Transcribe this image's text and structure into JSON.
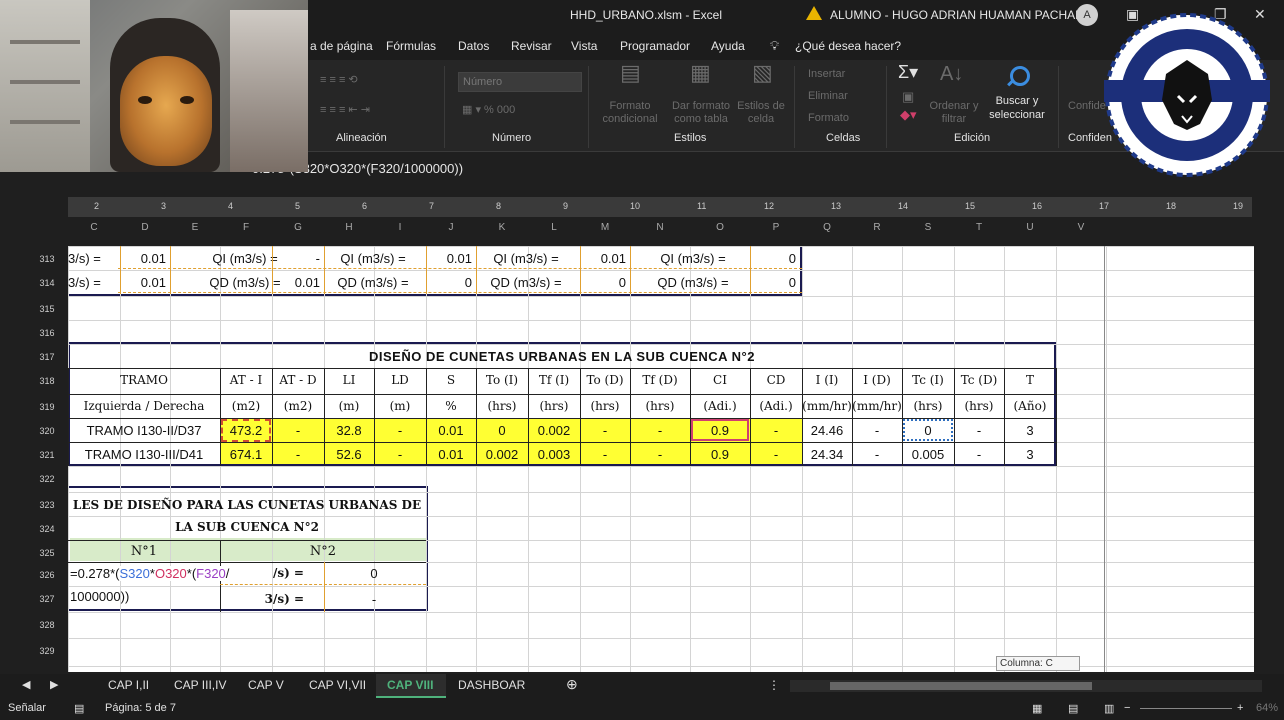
{
  "window": {
    "doc_title": "HHD_URBANO.xlsm  -  Excel",
    "user": "ALUMNO - HUGO ADRIAN HUAMAN PACHARI",
    "avatar": "A"
  },
  "menu": [
    "a de página",
    "Fórmulas",
    "Datos",
    "Revisar",
    "Vista",
    "Programador",
    "Ayuda",
    "¿Qué desea hacer?"
  ],
  "ribbon": {
    "number_format": "Número",
    "groups": [
      "Alineación",
      "Número",
      "Estilos",
      "Celdas",
      "Edición",
      "Confiden"
    ],
    "ghost_buttons": [
      "Formato condicional",
      "Dar formato como tabla",
      "Estilos de celda"
    ],
    "cells_buttons": [
      "Insertar",
      "Eliminar",
      "Formato"
    ],
    "edit_ghost": [
      "Ordenar y filtrar"
    ],
    "search_button": "Buscar y seleccionar",
    "conf_ghost": "Confide"
  },
  "formula_bar": {
    "text": "0.278*(S320*O320*(F320/1000000))"
  },
  "ruler_ticks": [
    "2",
    "3",
    "4",
    "5",
    "6",
    "7",
    "8",
    "9",
    "10",
    "11",
    "12",
    "13",
    "14",
    "15",
    "16",
    "17",
    "18",
    "19"
  ],
  "columns": [
    "C",
    "D",
    "E",
    "F",
    "G",
    "H",
    "I",
    "J",
    "K",
    "L",
    "M",
    "N",
    "O",
    "P",
    "Q",
    "R",
    "S",
    "T",
    "U",
    "V"
  ],
  "rows": [
    "313",
    "314",
    "315",
    "316",
    "317",
    "318",
    "319",
    "320",
    "321",
    "322",
    "323",
    "324",
    "325",
    "326",
    "327",
    "328",
    "329"
  ],
  "top_block": {
    "row313": [
      "3/s) =",
      "0.01",
      "QI (m3/s) =",
      "-",
      "QI (m3/s) =",
      "0.01",
      "QI (m3/s) =",
      "0.01",
      "QI (m3/s) =",
      "0"
    ],
    "row314": [
      "3/s) =",
      "0.01",
      "QD (m3/s) =",
      "0.01",
      "QD (m3/s) =",
      "0",
      "QD (m3/s) =",
      "0",
      "QD (m3/s) =",
      "0"
    ]
  },
  "design_table": {
    "title": "DISEÑO DE CUNETAS URBANAS EN LA SUB CUENCA N°2",
    "headers": [
      "TRAMO",
      "AT - I",
      "AT - D",
      "LI",
      "LD",
      "S",
      "To (I)",
      "Tf (I)",
      "To (D)",
      "Tf (D)",
      "CI",
      "CD",
      "I (I)",
      "I (D)",
      "Tc (I)",
      "Tc (D)",
      "T"
    ],
    "units": [
      "Izquierda / Derecha",
      "(m2)",
      "(m2)",
      "(m)",
      "(m)",
      "%",
      "(hrs)",
      "(hrs)",
      "(hrs)",
      "(hrs)",
      "(Adi.)",
      "(Adi.)",
      "(mm/hr)",
      "(mm/hr)",
      "(hrs)",
      "(hrs)",
      "(Año)"
    ],
    "rows": [
      [
        "TRAMO I130-II/D37",
        "473.2",
        "-",
        "32.8",
        "-",
        "0.01",
        "0",
        "0.002",
        "-",
        "-",
        "0.9",
        "-",
        "24.46",
        "-",
        "0",
        "-",
        "3"
      ],
      [
        "TRAMO I130-III/D41",
        "674.1",
        "-",
        "52.6",
        "-",
        "0.01",
        "0.002",
        "0.003",
        "-",
        "-",
        "0.9",
        "-",
        "24.34",
        "-",
        "0.005",
        "-",
        "3"
      ]
    ]
  },
  "caudales": {
    "title_line1": "LES DE DISEÑO PARA LAS CUNETAS URBANAS DE",
    "title_line2": "LA SUB CUENCA N°2",
    "col1": "N°1",
    "col2": "N°2",
    "formula_a": "=0.278*(",
    "formula_b": "S320",
    "formula_c": "*",
    "formula_d": "O320",
    "formula_e": "*(",
    "formula_f": "F320",
    "formula_g": "/",
    "formula_line2": "1000000))",
    "label1": "/s) =",
    "value1": "0",
    "label2": "3/s) =",
    "value2": "-"
  },
  "tooltip": "Columna: C",
  "tabs": [
    "CAP I,II",
    "CAP III,IV",
    "CAP V",
    "CAP VI,VII",
    "CAP VIII",
    "DASHBOAR"
  ],
  "active_tab": "CAP VIII",
  "status": {
    "mode": "Señalar",
    "page": "Página: 5 de 7",
    "zoom": "64%"
  },
  "colors": {
    "accent": "#4fb27c",
    "highlight": "#ffff33",
    "header_green": "#d8ebc9"
  }
}
